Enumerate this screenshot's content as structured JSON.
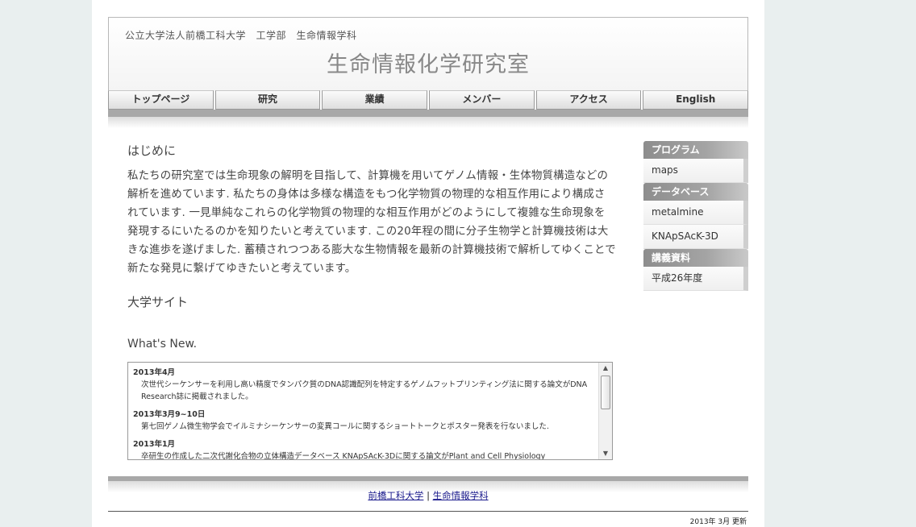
{
  "header": {
    "subtitle": "公立大学法人前橋工科大学　工学部　生命情報学科",
    "title": "生命情報化学研究室"
  },
  "nav": [
    "トップページ",
    "研究",
    "業績",
    "メンバー",
    "アクセス",
    "English"
  ],
  "main": {
    "heading": "はじめに",
    "intro": "私たちの研究室では生命現象の解明を目指して、計算機を用いてゲノム情報・生体物質構造などの解析を進めています. 私たちの身体は多様な構造をもつ化学物質の物理的な相互作用により構成されています. 一見単純なこれらの化学物質の物理的な相互作用がどのようにして複雑な生命現象を発現するにいたるのかを知りたいと考えています. この20年程の間に分子生物学と計算機技術は大きな進歩を遂げました. 蓄積されつつある膨大な生物情報を最新の計算機技術で解析してゆくことで新たな発見に繋げてゆきたいと考えています。",
    "university_heading": "大学サイト",
    "whats_new_heading": "What's New."
  },
  "news": [
    {
      "date": "2013年4月",
      "text": "次世代シーケンサーを利用し高い精度でタンパク質のDNA認識配列を特定するゲノムフットプリンティング法に関する論文がDNA Research誌に掲載されました。"
    },
    {
      "date": "2013年3月9~10日",
      "text": "第七回ゲノム微生物学会でイルミナシーケンサーの変異コールに関するショートトークとポスター発表を行ないました."
    },
    {
      "date": "2013年1月",
      "text": "卒研生の作成した二次代謝化合物の立体構造データベース KNApSAcK-3Dに関する論文がPlant and Cell Physiology"
    }
  ],
  "sidebar": [
    {
      "heading": "プログラム",
      "items": [
        "maps"
      ]
    },
    {
      "heading": "データベース",
      "items": [
        "metalmine",
        "KNApSAcK-3D"
      ]
    },
    {
      "heading": "講義資料",
      "items": [
        "平成26年度"
      ]
    }
  ],
  "footer": {
    "link1": "前橋工科大学",
    "separator": "|",
    "link2": "生命情報学科",
    "updated": "2013年 3月 更新"
  }
}
